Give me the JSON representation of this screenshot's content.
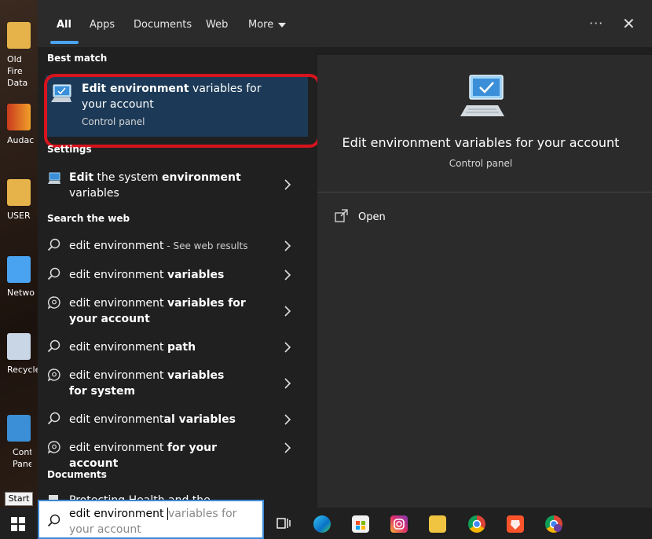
{
  "desktop": {
    "icons": [
      {
        "label": "Old Fire Data",
        "color": "#e6b34a"
      },
      {
        "label": "Audac",
        "color": "#c93a1e"
      },
      {
        "label": "USER",
        "color": "#e6b34a"
      },
      {
        "label": "Netwo",
        "color": "#4aa3f0"
      },
      {
        "label": "Recycle",
        "color": "#c9d6e6"
      },
      {
        "label": "Contr Pane",
        "color": "#3b8fd6"
      }
    ]
  },
  "tabs": [
    {
      "label": "All"
    },
    {
      "label": "Apps"
    },
    {
      "label": "Documents"
    },
    {
      "label": "Web"
    },
    {
      "label": "More"
    }
  ],
  "sections": {
    "best_match": "Best match",
    "settings": "Settings",
    "search_web": "Search the web",
    "documents": "Documents"
  },
  "best_match": {
    "title_bold": "Edit environment",
    "title_rest": " variables for your account",
    "subtitle": "Control panel"
  },
  "settings_item": {
    "p1": "Edit",
    "p2": " the system ",
    "p3": "environment",
    "p4": " variables"
  },
  "web_results": [
    {
      "normal": "edit environment",
      "bold": "",
      "suffix": " - See web results",
      "icon": "search-icon"
    },
    {
      "normal": "edit environment ",
      "bold": "variables",
      "suffix": "",
      "icon": "search-icon"
    },
    {
      "normal": "edit environment ",
      "bold": "variables for your account",
      "suffix": "",
      "icon": "chat-search-icon"
    },
    {
      "normal": "edit environment ",
      "bold": "path",
      "suffix": "",
      "icon": "search-icon"
    },
    {
      "normal": "edit environment ",
      "bold": "variables for system",
      "suffix": "",
      "icon": "chat-search-icon"
    },
    {
      "normal": "edit environment",
      "bold": "al variables",
      "suffix": "",
      "icon": "search-icon"
    },
    {
      "normal": "edit environment ",
      "bold": "for your account",
      "suffix": "",
      "icon": "chat-search-icon"
    }
  ],
  "documents_item": "Protecting Health and the",
  "preview": {
    "title": "Edit environment variables for your account",
    "subtitle": "Control panel",
    "action_open": "Open"
  },
  "tooltip": "Start",
  "search": {
    "value": "edit environment ",
    "placeholder": "variables for your account"
  },
  "colors": {
    "accent": "#4aa3f0",
    "selection": "#1c3a57",
    "highlight_ring": "#d6141d"
  }
}
